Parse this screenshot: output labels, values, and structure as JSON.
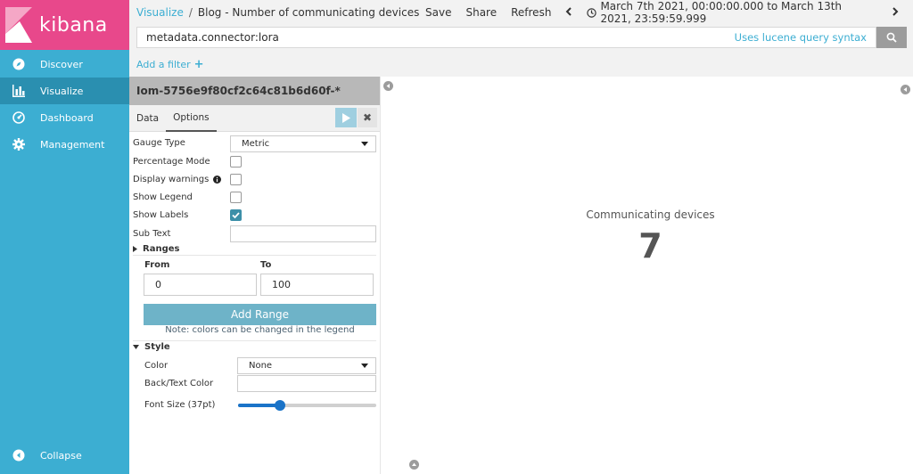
{
  "app": {
    "name": "kibana"
  },
  "sidebar": {
    "items": [
      {
        "label": "Discover",
        "icon": "compass-icon"
      },
      {
        "label": "Visualize",
        "icon": "bar-chart-icon",
        "active": true
      },
      {
        "label": "Dashboard",
        "icon": "dashboard-icon"
      },
      {
        "label": "Management",
        "icon": "gear-icon"
      }
    ],
    "collapse_label": "Collapse"
  },
  "topbar": {
    "breadcrumb_link": "Visualize",
    "breadcrumb_sep": "/",
    "title": "Blog - Number of communicating devices",
    "save": "Save",
    "share": "Share",
    "refresh": "Refresh",
    "time_range": "March 7th 2021, 00:00:00.000 to March 13th 2021, 23:59:59.999"
  },
  "query": {
    "value": "metadata.connector:lora",
    "syntax_link": "Uses lucene query syntax"
  },
  "filter": {
    "add_label": "Add a filter"
  },
  "editor": {
    "index_pattern": "Iom-5756e9f80cf2c64c81b6d60f-*",
    "tabs": [
      "Data",
      "Options"
    ],
    "active_tab": "Options",
    "gauge_type_label": "Gauge Type",
    "gauge_type_value": "Metric",
    "percentage_mode_label": "Percentage Mode",
    "percentage_mode": false,
    "display_warnings_label": "Display warnings",
    "display_warnings": false,
    "show_legend_label": "Show Legend",
    "show_legend": false,
    "show_labels_label": "Show Labels",
    "show_labels": true,
    "sub_text_label": "Sub Text",
    "sub_text_value": "",
    "ranges_title": "Ranges",
    "from_label": "From",
    "to_label": "To",
    "from_value": "0",
    "to_value": "100",
    "add_range_label": "Add Range",
    "note": "Note: colors can be changed in the legend",
    "style_title": "Style",
    "color_label": "Color",
    "color_value": "None",
    "back_text_color_label": "Back/Text Color",
    "font_size_label": "Font Size (37pt)",
    "font_size_level": 0.3
  },
  "visualization": {
    "label": "Communicating devices",
    "value": "7"
  },
  "colors": {
    "sidebar": "#3caed2",
    "logo": "#e8488b",
    "accent": "#3caed2"
  }
}
